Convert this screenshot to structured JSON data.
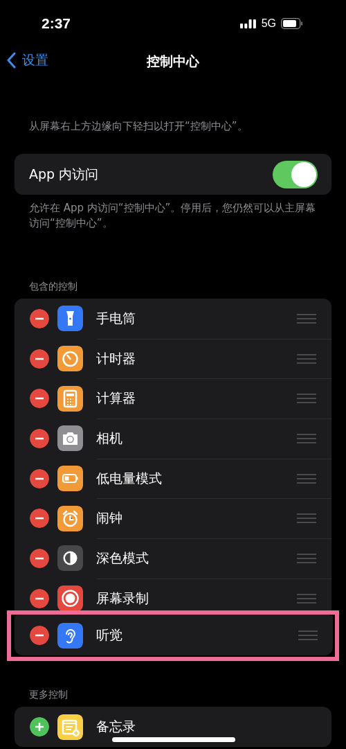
{
  "status_bar": {
    "time": "2:37",
    "network": "5G"
  },
  "nav": {
    "back": "设置",
    "title": "控制中心"
  },
  "intro": "从屏幕右上方边缘向下轻扫以打开“控制中心”。",
  "access": {
    "label": "App 内访问",
    "on": true
  },
  "access_note": "允许在 App 内访问“控制中心”。停用后，您仍然可以从主屏幕访问“控制中心”。",
  "included": {
    "header": "包含的控制",
    "items": [
      {
        "label": "手电筒",
        "kind": "flashlight",
        "color": "#3478f6",
        "highlighted": false
      },
      {
        "label": "计时器",
        "kind": "timer",
        "color": "#f19a37",
        "highlighted": false
      },
      {
        "label": "计算器",
        "kind": "calculator",
        "color": "#f19a37",
        "highlighted": false
      },
      {
        "label": "相机",
        "kind": "camera",
        "color": "#8e8e93",
        "highlighted": false
      },
      {
        "label": "低电量模式",
        "kind": "battery",
        "color": "#f19a37",
        "highlighted": false
      },
      {
        "label": "闹钟",
        "kind": "alarm",
        "color": "#f19a37",
        "highlighted": false
      },
      {
        "label": "深色模式",
        "kind": "darkmode",
        "color": "#48484a",
        "highlighted": false
      },
      {
        "label": "屏幕录制",
        "kind": "record",
        "color": "#e5483e",
        "highlighted": false
      },
      {
        "label": "听觉",
        "kind": "ear",
        "color": "#3478f6",
        "highlighted": true
      }
    ]
  },
  "more": {
    "header": "更多控制",
    "items": [
      {
        "label": "备忘录",
        "kind": "notes",
        "color": "#f8cf45"
      }
    ]
  }
}
